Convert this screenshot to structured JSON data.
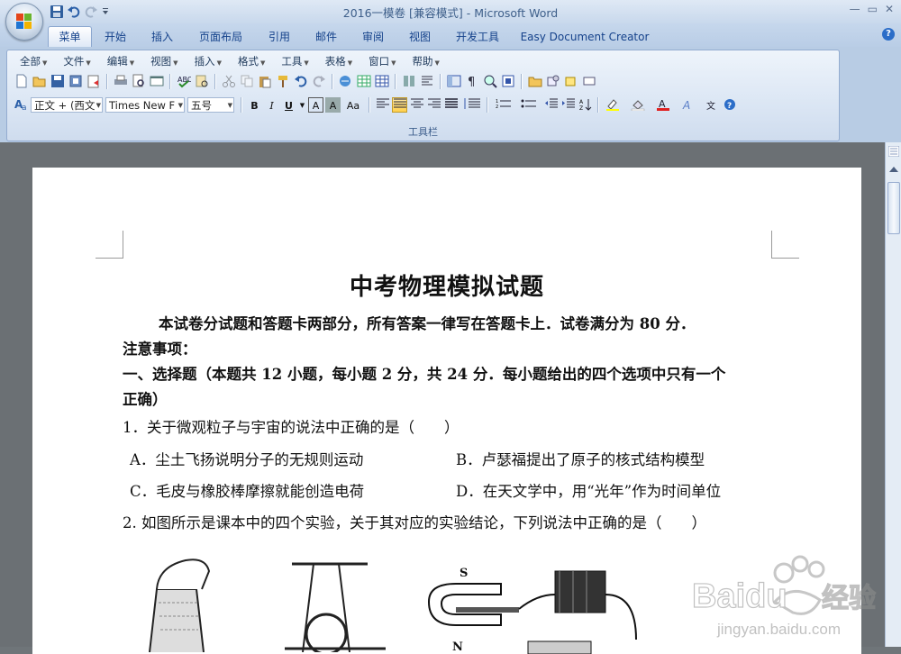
{
  "window": {
    "title": "2016一模卷 [兼容模式] - Microsoft Word",
    "controls": [
      "—",
      "▭",
      "✕"
    ]
  },
  "qat": {
    "icons": [
      "save-icon",
      "undo-icon",
      "redo-icon",
      "customize-icon"
    ]
  },
  "tabs": [
    "菜单",
    "开始",
    "插入",
    "页面布局",
    "引用",
    "邮件",
    "审阅",
    "视图",
    "开发工具",
    "Easy Document Creator"
  ],
  "active_tab": "菜单",
  "menubar": {
    "items": [
      "全部",
      "文件",
      "编辑",
      "视图",
      "插入",
      "格式",
      "工具",
      "表格",
      "窗口",
      "帮助"
    ]
  },
  "format_toolbar": {
    "style_value": "正文 + (西文",
    "font_value": "Times New F",
    "size_value": "五号",
    "bold": "B",
    "italic": "I",
    "underline": "U",
    "char_border": "A",
    "char_shade": "A",
    "change_case": "Aa"
  },
  "ribbon": {
    "group_label": "工具栏"
  },
  "document": {
    "title": "中考物理模拟试题",
    "intro": "本试卷分试题和答题卡两部分，所有答案一律写在答题卡上．试卷满分为 80 分．",
    "notice": "注意事项：",
    "section1_line1": "一、选择题（本题共 12 小题，每小题 2 分，共 24 分．每小题给出的四个选项中只有一个",
    "section1_line2": "正确）",
    "q1": "1．关于微观粒子与宇宙的说法中正确的是（　　）",
    "q1_a": "A．尘土飞扬说明分子的无规则运动",
    "q1_b": "B．卢瑟福提出了原子的核式结构模型",
    "q1_c": "C．毛皮与橡胶棒摩擦就能创造电荷",
    "q1_d": "D．在天文学中，用“光年”作为时间单位",
    "q2": "2. 如图所示是课本中的四个实验，关于其对应的实验结论，下列说法中正确的是（　　）",
    "magnet_s": "S",
    "magnet_n": "N"
  },
  "watermark": {
    "brand": "Baidu",
    "text": "经验",
    "url": "jingyan.baidu.com"
  },
  "colors": {
    "ribbon_bg": "#b8cce4",
    "tab_text": "#15428b",
    "title_text": "#3e5f8a",
    "highlight": "#ffd04c"
  }
}
